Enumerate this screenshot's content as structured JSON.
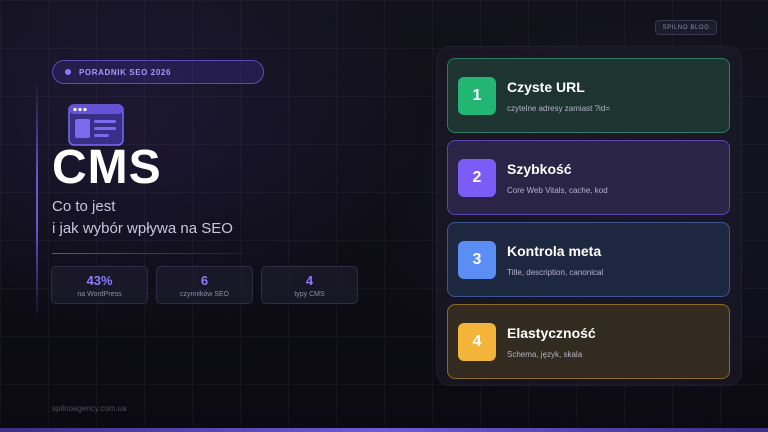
{
  "badge": {
    "label": "PORADNIK SEO 2026"
  },
  "brand": {
    "label": "SPILNO BLOG"
  },
  "hero": {
    "title": "CMS",
    "subtitle_line1": "Co to jest",
    "subtitle_line2": "i jak wybór wpływa na SEO"
  },
  "stats": [
    {
      "value": "43%",
      "label": "na WordPress"
    },
    {
      "value": "6",
      "label": "czynników SEO"
    },
    {
      "value": "4",
      "label": "typy CMS"
    }
  ],
  "footer": {
    "url": "spilnoagency.com.ua"
  },
  "cards": [
    {
      "number": "1",
      "title": "Czyste URL",
      "desc": "czytelne adresy zamiast ?id="
    },
    {
      "number": "2",
      "title": "Szybkość",
      "desc": "Core Web Vitals, cache, kod"
    },
    {
      "number": "3",
      "title": "Kontrola meta",
      "desc": "Title, description, canonical"
    },
    {
      "number": "4",
      "title": "Elastyczność",
      "desc": "Schema, język, skala"
    }
  ],
  "colors": {
    "accent": "#7b5cf6",
    "card1": "#22b573",
    "card2": "#7b5cf6",
    "card3": "#5b8ef5",
    "card4": "#f2b53a"
  },
  "icons": {
    "hero": "browser-window-icon"
  }
}
